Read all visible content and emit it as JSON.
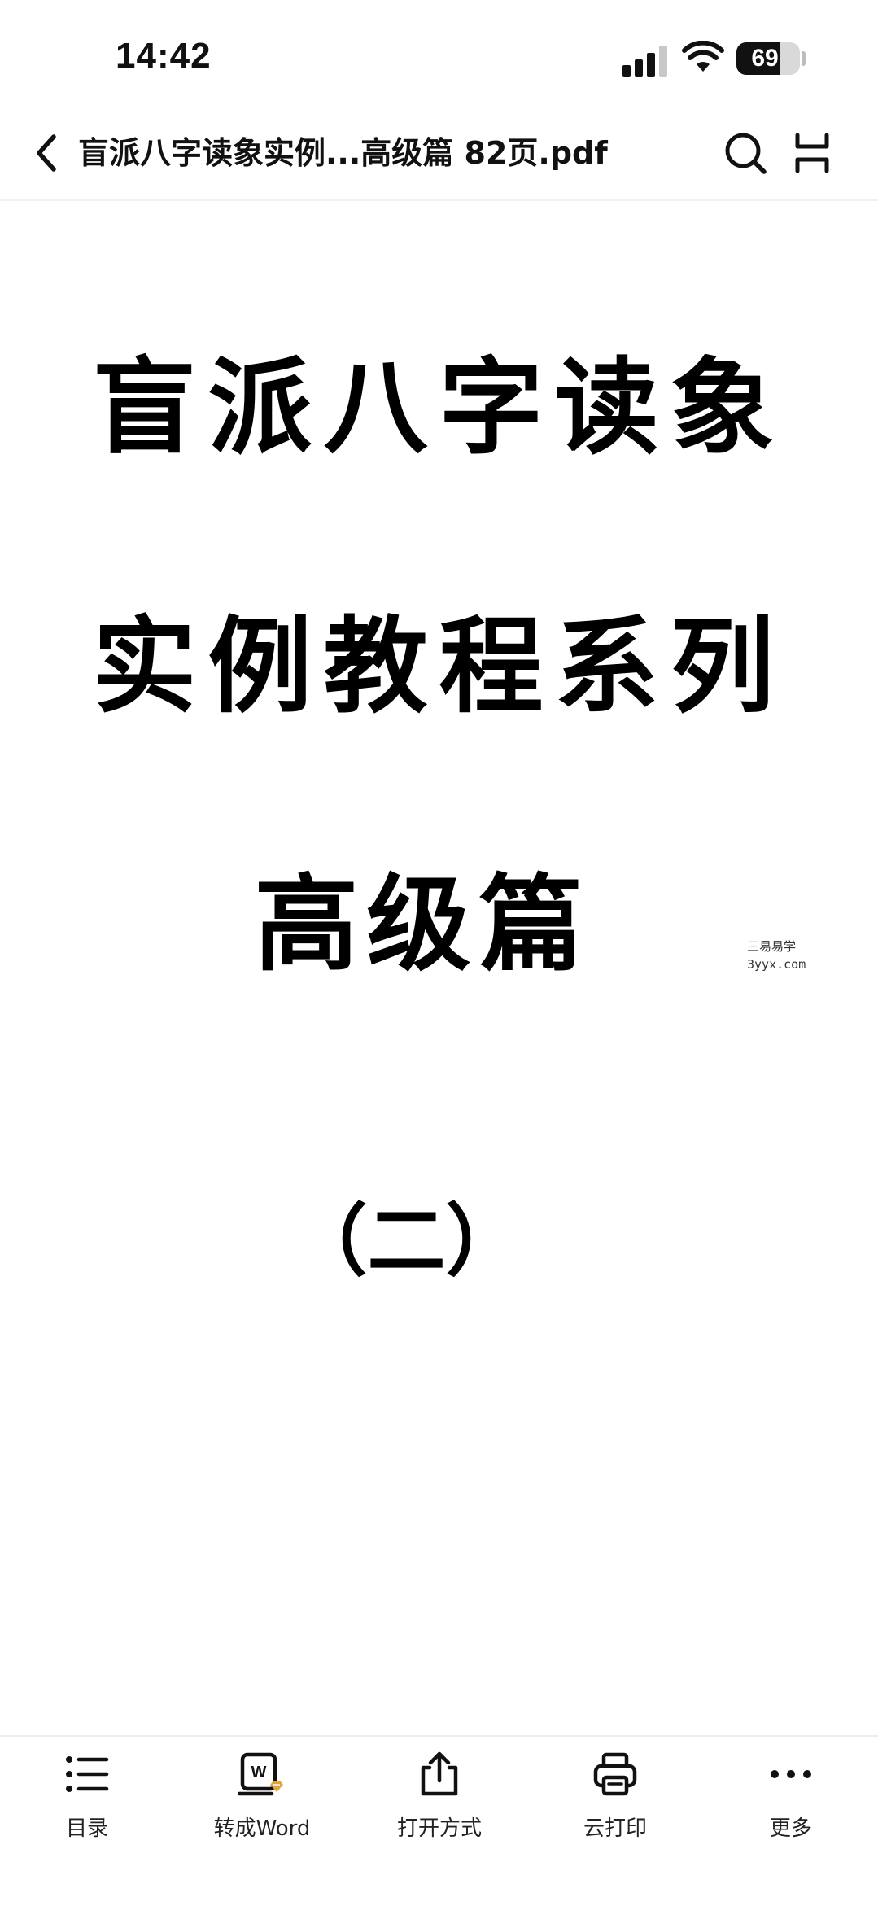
{
  "status_bar": {
    "time": "14:42",
    "battery_level": "69",
    "battery_fraction": 0.69
  },
  "header": {
    "title": "盲派八字读象实例...高级篇 82页.pdf"
  },
  "document": {
    "line1": "盲派八字读象",
    "line2": "实例教程系列",
    "line3": "高级篇",
    "line4": "（二）",
    "watermark_line1": "三易易学",
    "watermark_line2": "3yyx.com"
  },
  "toolbar": {
    "items": [
      {
        "label": "目录",
        "icon": "list-icon"
      },
      {
        "label": "转成Word",
        "icon": "word-convert-icon"
      },
      {
        "label": "打开方式",
        "icon": "share-icon"
      },
      {
        "label": "云打印",
        "icon": "printer-icon"
      },
      {
        "label": "更多",
        "icon": "more-icon"
      }
    ]
  },
  "colors": {
    "text": "#111111",
    "accent": "#e0a43a",
    "divider": "#eeeeee"
  }
}
